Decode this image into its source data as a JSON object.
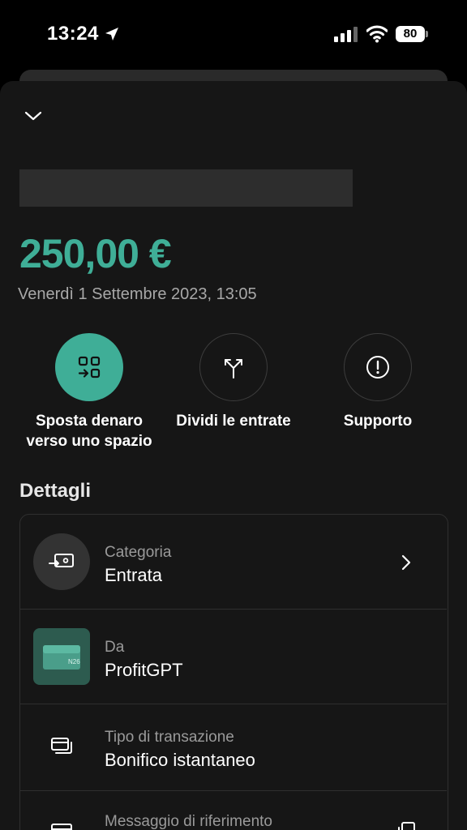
{
  "status_bar": {
    "time": "13:24",
    "battery_level": "80"
  },
  "transaction": {
    "amount": "250,00 €",
    "date": "Venerdì 1 Settembre 2023, 13:05"
  },
  "actions": [
    {
      "label_line1": "Sposta denaro",
      "label_line2": "verso uno spazio"
    },
    {
      "label_line1": "Dividi le entrate",
      "label_line2": ""
    },
    {
      "label_line1": "Supporto",
      "label_line2": ""
    }
  ],
  "details": {
    "title": "Dettagli",
    "rows": [
      {
        "label": "Categoria",
        "value": "Entrata"
      },
      {
        "label": "Da",
        "value": "ProfitGPT",
        "card_mark": "N26"
      },
      {
        "label": "Tipo di transazione",
        "value": "Bonifico istantaneo"
      },
      {
        "label": "Messaggio di riferimento",
        "value": ""
      }
    ]
  },
  "colors": {
    "accent": "#3fae97",
    "background": "#161616",
    "muted_text": "#9a9a9a"
  },
  "icons": {
    "collapse": "chevron-down-icon",
    "move_money": "move-to-space-icon",
    "split_income": "split-arrows-icon",
    "support": "exclamation-circle-icon",
    "category": "income-card-icon",
    "from": "wallet-card-icon",
    "transaction_type": "cards-icon",
    "reference_message": "message-icon",
    "copy": "copy-icon"
  }
}
